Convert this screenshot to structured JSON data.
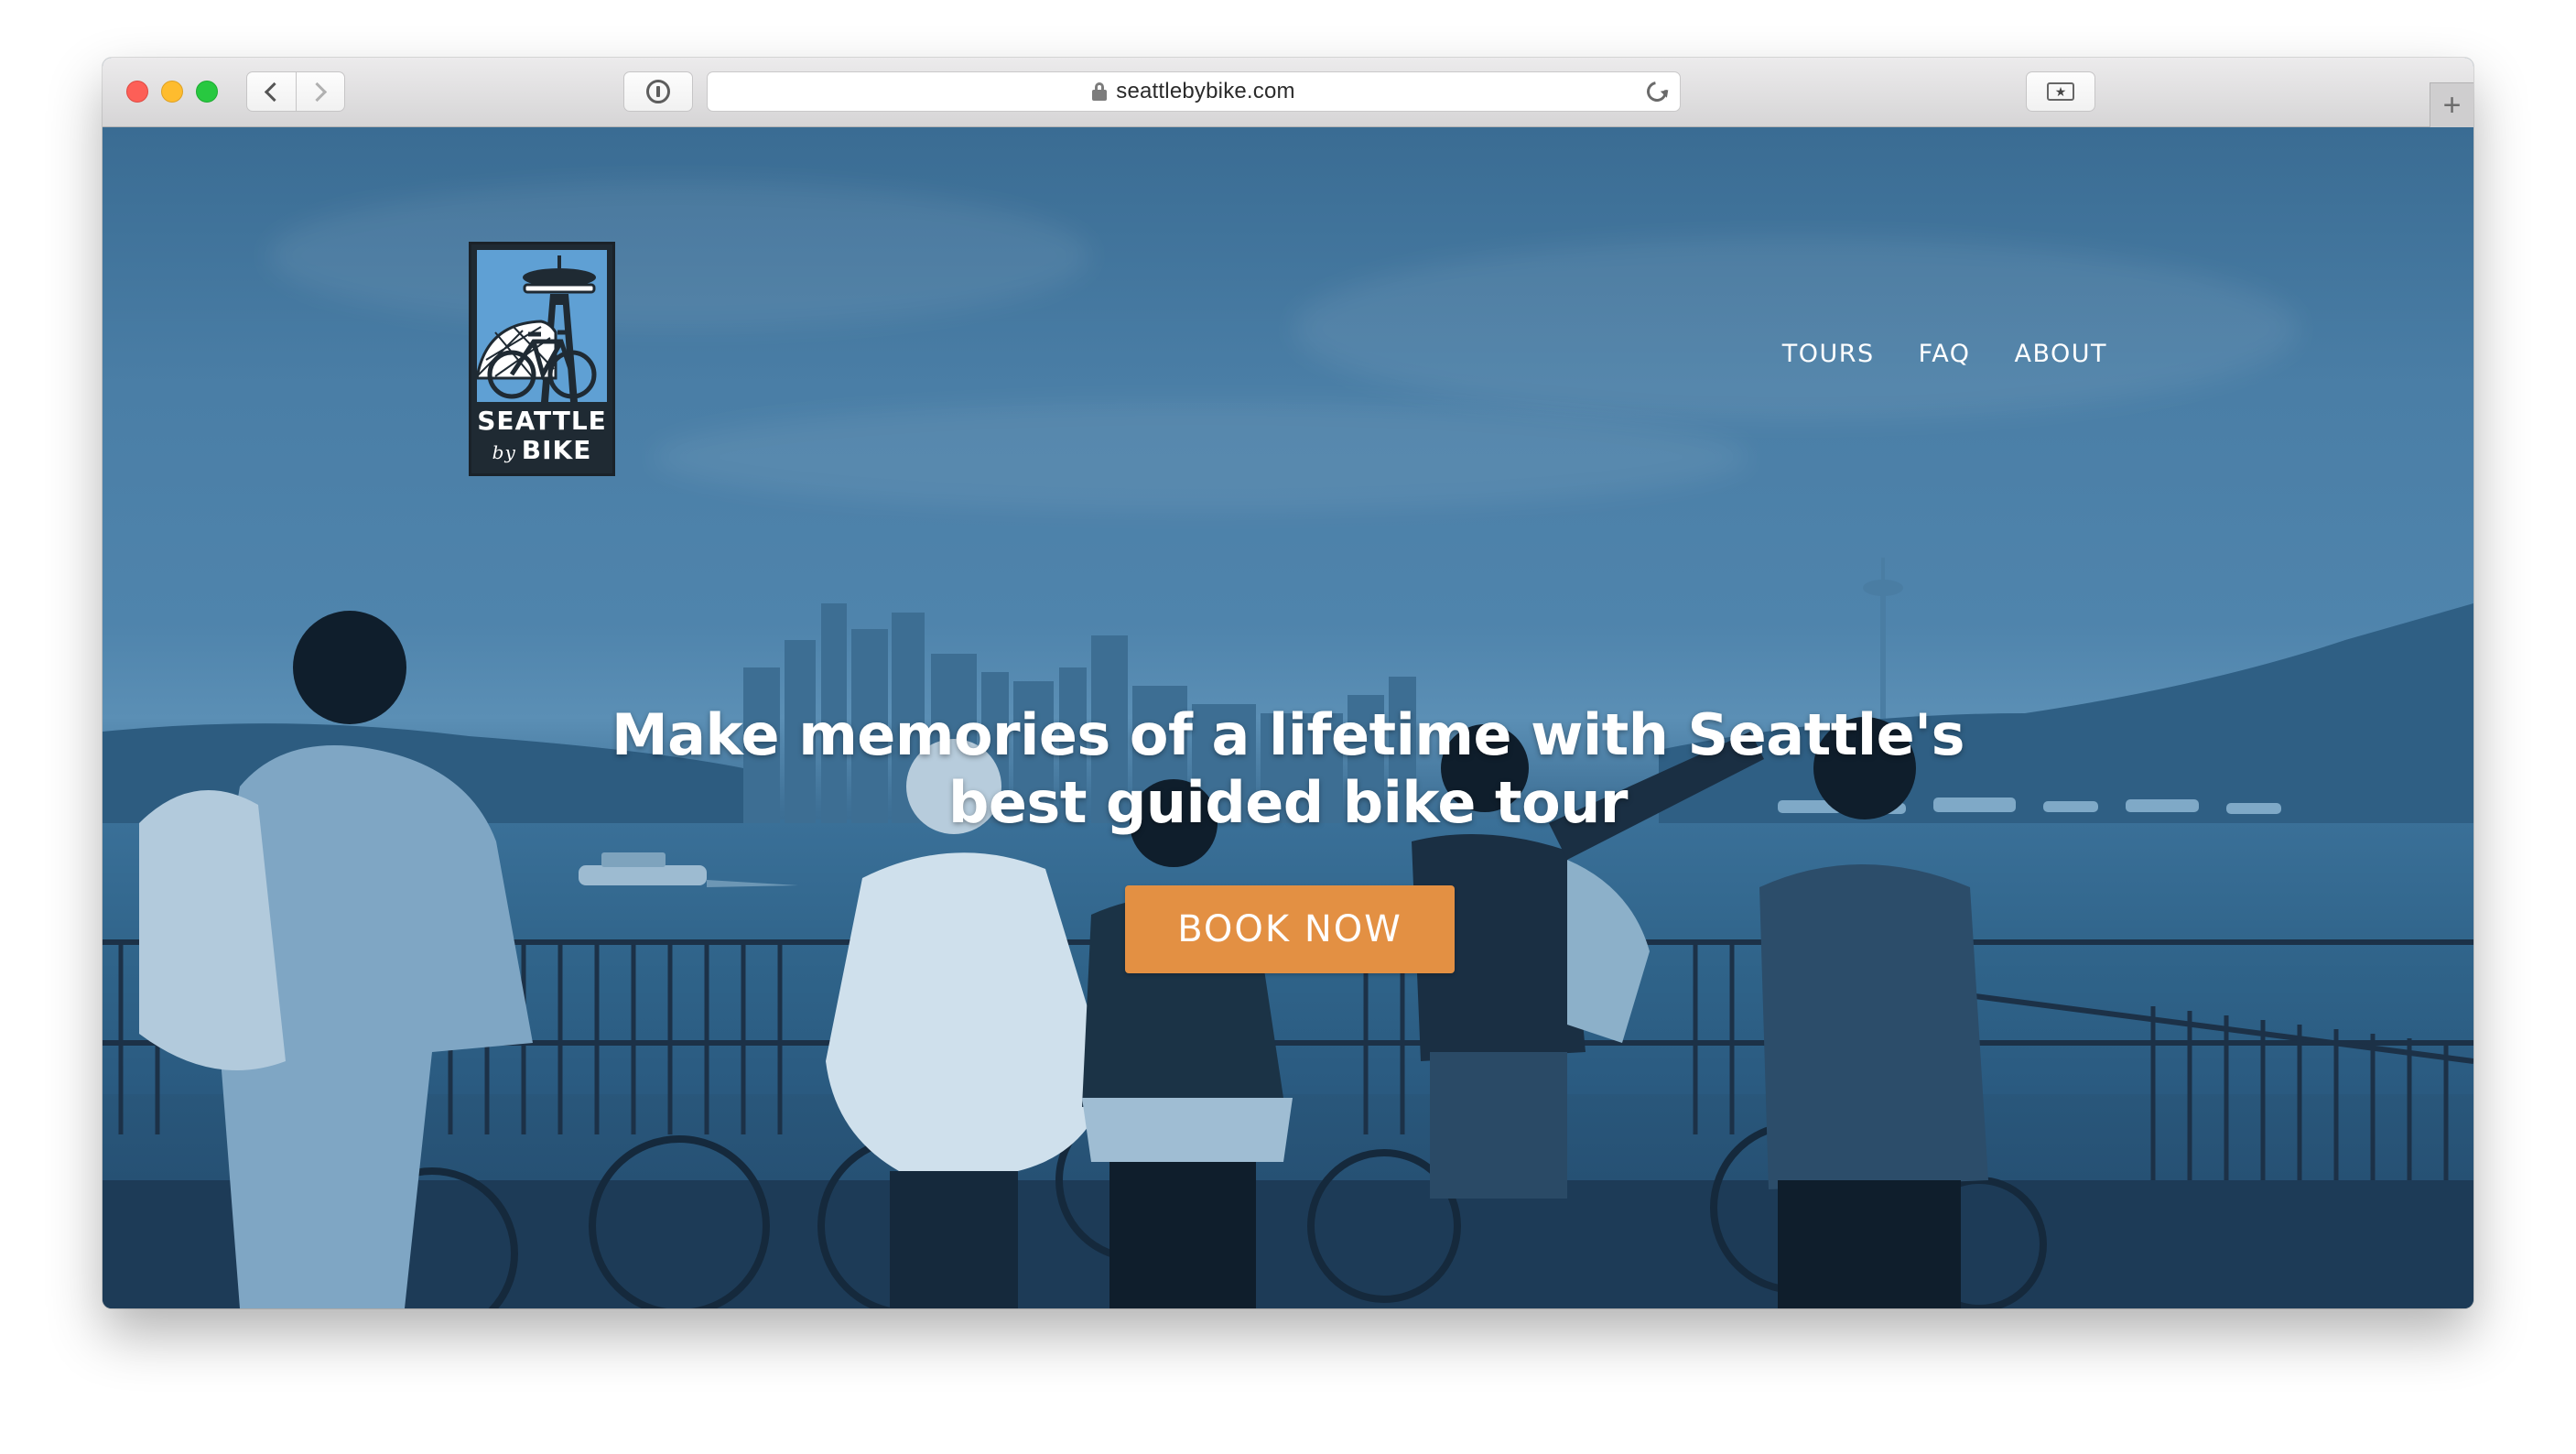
{
  "browser": {
    "url": "seattlebybike.com"
  },
  "site": {
    "logo": {
      "line1": "SEATTLE",
      "line2_small": "by",
      "line2": "BIKE"
    },
    "nav": [
      {
        "label": "TOURS"
      },
      {
        "label": "FAQ"
      },
      {
        "label": "ABOUT"
      }
    ],
    "hero": {
      "headline_line1": "Make memories of a lifetime with Seattle's",
      "headline_line2": "best guided bike tour",
      "cta_label": "BOOK NOW"
    }
  },
  "colors": {
    "hero_tint": "#3a6c93",
    "cta": "#e39043",
    "logo_bg": "#1f2a33",
    "logo_art": "#5fa0d4"
  },
  "icons": [
    "back-chevron-icon",
    "forward-chevron-icon",
    "reader-icon",
    "lock-icon",
    "reload-icon",
    "share-icon",
    "new-tab-plus-icon"
  ]
}
